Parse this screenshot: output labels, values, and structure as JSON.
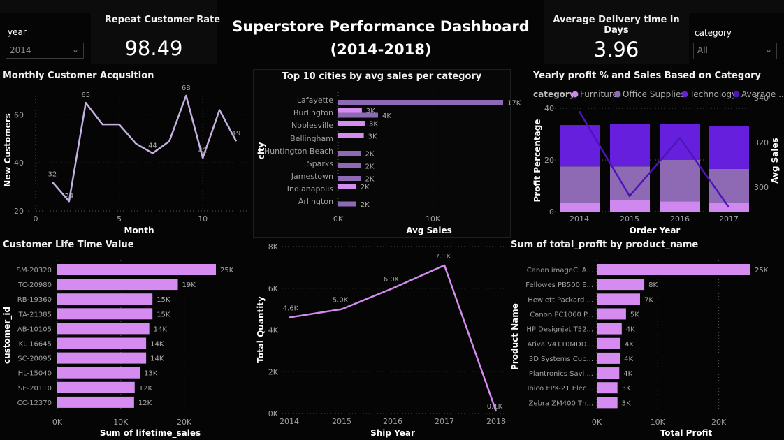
{
  "header": {
    "title": "Superstore Performance Dashboard",
    "subtitle": "(2014-2018)",
    "kpi_left": {
      "label": "Repeat Customer Rate",
      "value": "98.49"
    },
    "kpi_right": {
      "label": "Average Delivery time in Days",
      "value": "3.96"
    }
  },
  "slicers": {
    "year": {
      "label": "year",
      "value": "2014"
    },
    "category": {
      "label": "category",
      "value": "All"
    }
  },
  "colors": {
    "line": "#c4b1e0",
    "bar_pink": "#d58bf0",
    "bar_purple": "#8e6ab5",
    "furniture": "#cf88ee",
    "office": "#8e6ab5",
    "technology": "#6620dd",
    "avg_line": "#4d15b8",
    "ship_line": "#d58bf0"
  },
  "chart_data": [
    {
      "id": "acq",
      "type": "line",
      "title": "Monthly Customer Acqusition",
      "xlabel": "Month",
      "ylabel": "New Customers",
      "x": [
        1,
        2,
        3,
        4,
        5,
        6,
        7,
        8,
        9,
        10,
        11,
        12
      ],
      "values": [
        32,
        24,
        65,
        56,
        56,
        48,
        44,
        49,
        68,
        42,
        62,
        49
      ],
      "point_labels": [
        "32",
        "24",
        "65",
        "",
        "",
        "",
        "44",
        "",
        "68",
        "42",
        "",
        "49"
      ],
      "xlim": [
        0,
        12.5
      ],
      "ylim": [
        20,
        70
      ],
      "xticks": [
        0,
        5,
        10
      ],
      "yticks": [
        20,
        40,
        60
      ],
      "grid": true
    },
    {
      "id": "cities",
      "type": "bar",
      "orientation": "horizontal",
      "title": "Top 10 cities by avg sales per category",
      "xlabel": "Avg Sales",
      "ylabel": "city",
      "categories": [
        "Lafayette",
        "Burlington",
        "Noblesville",
        "Bellingham",
        "Huntington Beach",
        "Sparks",
        "Jamestown",
        "Indianapolis",
        "Arlington"
      ],
      "bars": [
        {
          "city": "Lafayette",
          "value": 17400,
          "label": "17K",
          "color": "purple"
        },
        {
          "city": "Burlington",
          "value": 2500,
          "label": "3K",
          "color": "pink"
        },
        {
          "city": "Burlington",
          "value": 4200,
          "label": "4K",
          "color": "purple"
        },
        {
          "city": "Noblesville",
          "value": 2800,
          "label": "3K",
          "color": "pink"
        },
        {
          "city": "Bellingham",
          "value": 2700,
          "label": "3K",
          "color": "pink"
        },
        {
          "city": "Huntington Beach",
          "value": 2400,
          "label": "2K",
          "color": "purple"
        },
        {
          "city": "Sparks",
          "value": 2400,
          "label": "2K",
          "color": "purple"
        },
        {
          "city": "Jamestown",
          "value": 2400,
          "label": "2K",
          "color": "purple"
        },
        {
          "city": "Indianapolis",
          "value": 1900,
          "label": "2K",
          "color": "pink"
        },
        {
          "city": "Arlington",
          "value": 1900,
          "label": "2K",
          "color": "purple"
        }
      ],
      "xlim": [
        0,
        18000
      ],
      "xticks": [
        "0K",
        "10K"
      ],
      "xtick_values": [
        0,
        10000
      ],
      "grid": true
    },
    {
      "id": "yearly",
      "type": "bar",
      "stacked": true,
      "title": "Yearly profit % and Sales Based on Category",
      "legend_title": "category",
      "legend": [
        "Furniture",
        "Office Supplies",
        "Technology",
        "Average ..."
      ],
      "xlabel": "Order Year",
      "ylabel": "Profit Percentage",
      "y2label": "Avg Sales",
      "categories": [
        "2014",
        "2015",
        "2016",
        "2017"
      ],
      "series": [
        {
          "name": "Furniture",
          "values": [
            3.5,
            4.5,
            4.0,
            3.5
          ]
        },
        {
          "name": "Office Supplies",
          "values": [
            14,
            13,
            16,
            13
          ]
        },
        {
          "name": "Technology",
          "values": [
            16,
            16.5,
            14,
            16.5
          ]
        }
      ],
      "avg_line": [
        334,
        296,
        322,
        291
      ],
      "ylim": [
        0,
        40
      ],
      "y2lim": [
        289,
        341
      ],
      "yticks": [
        0,
        20,
        40
      ],
      "y2ticks": [
        300,
        320,
        340
      ],
      "grid": true
    },
    {
      "id": "ltv",
      "type": "bar",
      "orientation": "horizontal",
      "title": "Customer Life Time Value",
      "xlabel": "Sum of lifetime_sales",
      "ylabel": "customer_id",
      "categories": [
        "SM-20320",
        "TC-20980",
        "RB-19360",
        "TA-21385",
        "AB-10105",
        "KL-16645",
        "SC-20095",
        "HL-15040",
        "SE-20110",
        "CC-12370"
      ],
      "values": [
        25000,
        19000,
        15000,
        15000,
        14500,
        14000,
        14000,
        13000,
        12200,
        12100
      ],
      "data_labels": [
        "25K",
        "19K",
        "15K",
        "15K",
        "14K",
        "14K",
        "14K",
        "13K",
        "12K",
        "12K"
      ],
      "xlim": [
        0,
        26000
      ],
      "xticks": [
        "0K",
        "10K",
        "20K"
      ],
      "xtick_values": [
        0,
        10000,
        20000
      ],
      "grid": true
    },
    {
      "id": "ship",
      "type": "line",
      "xlabel": "Ship Year",
      "ylabel": "Total Quantity",
      "categories": [
        "2014",
        "2015",
        "2016",
        "2017",
        "2018"
      ],
      "values": [
        4600,
        5000,
        6000,
        7100,
        100
      ],
      "data_labels": [
        "4.6K",
        "5.0K",
        "6.0K",
        "7.1K",
        "0.1K"
      ],
      "ylim": [
        0,
        8000
      ],
      "yticks": [
        "0K",
        "2K",
        "4K",
        "6K",
        "8K"
      ],
      "ytick_values": [
        0,
        2000,
        4000,
        6000,
        8000
      ],
      "grid": true
    },
    {
      "id": "profit",
      "type": "bar",
      "orientation": "horizontal",
      "title": "Sum of total_profit by product_name",
      "xlabel": "Total Profit",
      "ylabel": "Product Name",
      "categories": [
        "Canon imageCLA...",
        "Fellowes PB500 E...",
        "Hewlett Packard ...",
        "Canon PC1060 P...",
        "HP Designjet T52...",
        "Ativa V4110MDD...",
        "3D Systems Cub...",
        "Plantronics Savi ...",
        "Ibico EPK-21 Elec...",
        "Zebra ZM400 Th..."
      ],
      "values": [
        25200,
        7800,
        7100,
        4800,
        4100,
        3900,
        3800,
        3700,
        3400,
        3400
      ],
      "data_labels": [
        "25K",
        "8K",
        "7K",
        "5K",
        "4K",
        "4K",
        "4K",
        "4K",
        "3K",
        "3K"
      ],
      "xlim": [
        0,
        26500
      ],
      "xticks": [
        "0K",
        "10K",
        "20K"
      ],
      "xtick_values": [
        0,
        10000,
        20000
      ],
      "grid": true
    }
  ]
}
